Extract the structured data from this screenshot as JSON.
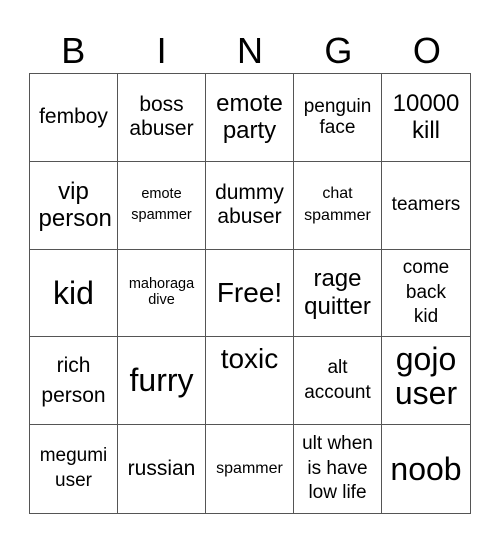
{
  "header": {
    "letters": [
      "B",
      "I",
      "N",
      "G",
      "O"
    ]
  },
  "cells": [
    "femboy",
    "boss abuser",
    "emote party",
    "penguin face",
    "10000 kill",
    "vip person",
    "emote spammer",
    "dummy abuser",
    "chat spammer",
    "teamers",
    "kid",
    "mahoraga dive",
    "Free!",
    "rage quitter",
    "come back kid",
    "rich person",
    "furry",
    "toxic",
    "alt account",
    "gojo user",
    "megumi user",
    "russian",
    "spammer",
    "ult when is have low life",
    "noob"
  ],
  "cells_display": {
    "r0c0": "femboy",
    "r0c1": "boss\nabuser",
    "r0c2": "emote\nparty",
    "r0c3": "penguin\nface",
    "r0c4": "10000\nkill",
    "r1c0": "vip\nperson",
    "r1c1": "emote\nspammer",
    "r1c2": "dummy\nabuser",
    "r1c3": "chat\nspammer",
    "r1c4": "teamers"
  }
}
